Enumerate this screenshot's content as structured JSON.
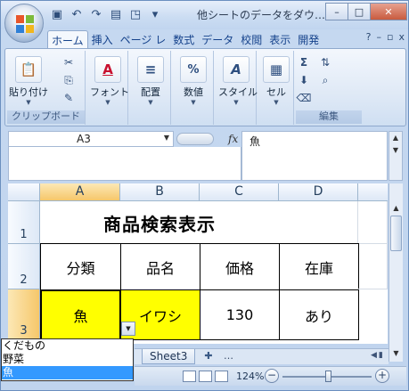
{
  "window": {
    "title": "他シートのデータをダウ…",
    "buttons": {
      "minimize": "–",
      "restore": "□",
      "close": "✕"
    }
  },
  "qat": {
    "dropdown": "▾"
  },
  "tabs": [
    "ホーム",
    "挿入",
    "ページ レ",
    "数式",
    "データ",
    "校閲",
    "表示",
    "開発"
  ],
  "tab_right": {
    "help": "?",
    "minimize": "–",
    "restore": "▫",
    "close": "x"
  },
  "ribbon": {
    "paste_label": "貼り付け",
    "clipboard_label": "クリップボード",
    "font_label": "フォント",
    "alignment_label": "配置",
    "number_label": "数値",
    "style_label": "スタイル",
    "cells_label": "セル",
    "editing_label": "編集",
    "sum_symbol": "Σ"
  },
  "formula_bar": {
    "name_box": "A3",
    "fx": "fx",
    "formula": "魚"
  },
  "columns": [
    "A",
    "B",
    "C",
    "D"
  ],
  "rows": [
    "1",
    "2",
    "3"
  ],
  "sheet": {
    "title": "商品検索表示",
    "headers": [
      "分類",
      "品名",
      "価格",
      "在庫"
    ],
    "row3": [
      "魚",
      "イワシ",
      "130",
      "あり"
    ]
  },
  "dropdown": {
    "items": [
      "くだもの",
      "野菜",
      "魚"
    ],
    "selected_index": 2
  },
  "sheet_tabs": {
    "active": "Sheet3",
    "more": "…"
  },
  "status": {
    "zoom": "124%",
    "minus": "−",
    "plus": "+"
  },
  "colors": {
    "highlight": "#ffff00",
    "selected_item": "#3399ff"
  }
}
